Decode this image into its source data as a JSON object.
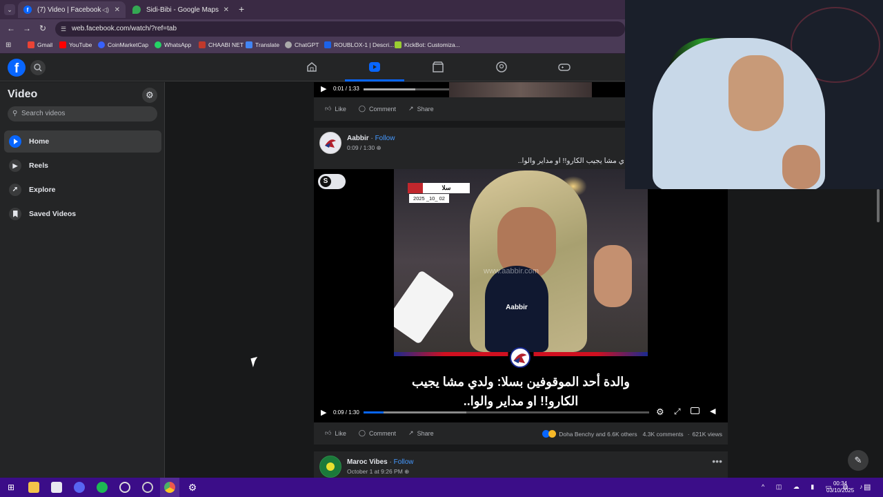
{
  "browser": {
    "tabs": [
      {
        "title": "(7) Video | Facebook",
        "active": true
      },
      {
        "title": "Sidi-Bibi - Google Maps",
        "active": false
      }
    ],
    "url": "web.facebook.com/watch/?ref=tab",
    "bookmarks": [
      "Gmail",
      "YouTube",
      "CoinMarketCap",
      "WhatsApp",
      "CHAABI NET",
      "Translate",
      "ChatGPT",
      "ROUBLOX-1 | Descri...",
      "KickBot: Customiza..."
    ]
  },
  "sidebar": {
    "title": "Video",
    "search_placeholder": "Search videos",
    "items": [
      {
        "label": "Home",
        "active": true
      },
      {
        "label": "Reels",
        "active": false
      },
      {
        "label": "Explore",
        "active": false
      },
      {
        "label": "Saved Videos",
        "active": false
      }
    ]
  },
  "top_video": {
    "time": "0:01 / 1:33",
    "actions": {
      "like": "Like",
      "comment": "Comment",
      "share": "Share"
    }
  },
  "post1": {
    "author": "Aabbir",
    "follow": "Follow",
    "time": "0:09 / 1:30",
    "caption": "ي مشا يجيب الكارو!! او مداير والوا..",
    "video_badge_letter": "S",
    "video_label_city": "سلا",
    "video_label_date": "2025 _10_ 02",
    "watermark": "www.aabbir.com",
    "mic_brand": "Aabbir",
    "subtitle_line1": "والدة أحد الموقوفين بسلا: ولدي مشا يجيب",
    "subtitle_line2": "الكارو!! او مداير والوا..",
    "progress": 0.07,
    "buffered": 0.36,
    "actions": {
      "like": "Like",
      "comment": "Comment",
      "share": "Share"
    },
    "reactions": "Doha Benchy and 6.6K others",
    "comments": "4.3K comments",
    "views": "621K views"
  },
  "post2": {
    "author": "Maroc Vibes",
    "follow": "Follow",
    "time": "October 1 at 9:26 PM"
  },
  "taskbar": {
    "time": "00:34",
    "date": "03/10/2025"
  },
  "colors": {
    "fb_blue": "#0866ff",
    "link": "#4599ff",
    "taskbar": "#3b0d88",
    "chrome": "#4a3a56"
  }
}
